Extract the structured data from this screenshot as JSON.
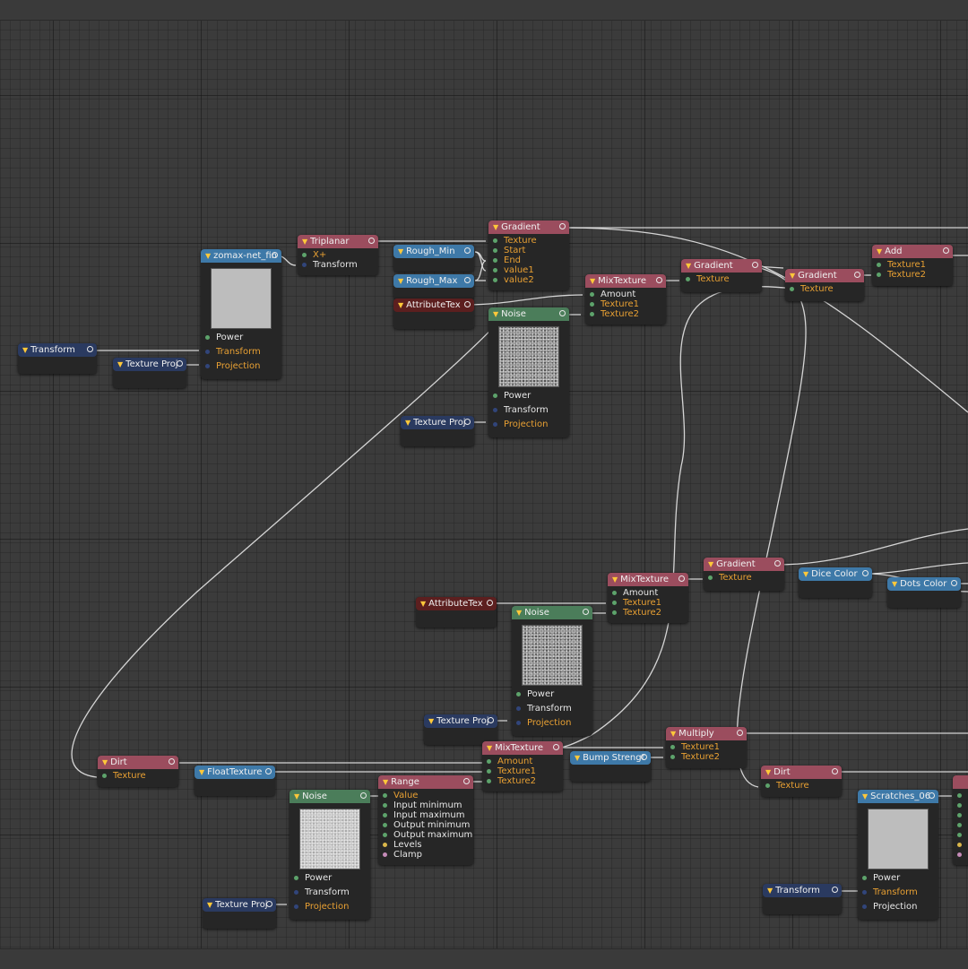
{
  "nodes": {
    "transform_left": {
      "title": "Transform"
    },
    "texproj_1": {
      "title": "Texture Proj"
    },
    "zomax": {
      "title": "zomax-net_fin",
      "rows": [
        "Power",
        "Transform",
        "Projection"
      ]
    },
    "triplanar": {
      "title": "Triplanar",
      "rows": [
        "X+",
        "Transform"
      ]
    },
    "rough_min": {
      "title": "Rough_Min"
    },
    "rough_max": {
      "title": "Rough_Max"
    },
    "attrtex_1": {
      "title": "AttributeTex"
    },
    "gradient_1": {
      "title": "Gradient",
      "rows": [
        "Texture",
        "Start",
        "End",
        "value1",
        "value2"
      ]
    },
    "noise_1": {
      "title": "Noise",
      "rows": [
        "Power",
        "Transform",
        "Projection"
      ]
    },
    "texproj_2": {
      "title": "Texture Proj"
    },
    "mixtex_1": {
      "title": "MixTexture",
      "rows": [
        "Amount",
        "Texture1",
        "Texture2"
      ]
    },
    "gradient_2": {
      "title": "Gradient",
      "rows": [
        "Texture"
      ]
    },
    "gradient_3": {
      "title": "Gradient",
      "rows": [
        "Texture"
      ]
    },
    "add": {
      "title": "Add",
      "rows": [
        "Texture1",
        "Texture2"
      ]
    },
    "attrtex_2": {
      "title": "AttributeTex"
    },
    "mixtex_2": {
      "title": "MixTexture",
      "rows": [
        "Amount",
        "Texture1",
        "Texture2"
      ]
    },
    "noise_2": {
      "title": "Noise",
      "rows": [
        "Power",
        "Transform",
        "Projection"
      ]
    },
    "texproj_3": {
      "title": "Texture Proj"
    },
    "gradient_4": {
      "title": "Gradient",
      "rows": [
        "Texture"
      ]
    },
    "dice_color": {
      "title": "Dice Color"
    },
    "dots_color": {
      "title": "Dots Color"
    },
    "dirt_1": {
      "title": "Dirt",
      "rows": [
        "Texture"
      ]
    },
    "floattex": {
      "title": "FloatTexture"
    },
    "mixtex_3": {
      "title": "MixTexture",
      "rows": [
        "Amount",
        "Texture1",
        "Texture2"
      ]
    },
    "bump": {
      "title": "Bump Strengt"
    },
    "multiply": {
      "title": "Multiply",
      "rows": [
        "Texture1",
        "Texture2"
      ]
    },
    "range": {
      "title": "Range",
      "rows": [
        "Value",
        "Input minimum",
        "Input maximum",
        "Output minimum",
        "Output maximum",
        "Levels",
        "Clamp"
      ]
    },
    "noise_3": {
      "title": "Noise",
      "rows": [
        "Power",
        "Transform",
        "Projection"
      ]
    },
    "texproj_4": {
      "title": "Texture Proj"
    },
    "dirt_2": {
      "title": "Dirt",
      "rows": [
        "Texture"
      ]
    },
    "scratches": {
      "title": "Scratches_06",
      "rows": [
        "Power",
        "Transform",
        "Projection"
      ]
    },
    "transform_right": {
      "title": "Transform"
    }
  },
  "colors": {
    "canvas_bg": "#3b3b3b",
    "node_body": "#262626",
    "header_texture": "#9b4d5e",
    "header_attribute": "#5c1f1f",
    "header_value": "#3e79a8",
    "header_transform": "#2a3a60",
    "header_noise": "#4b7d5a",
    "wire": "#e6e6e6",
    "label_orange": "#e8a033"
  }
}
